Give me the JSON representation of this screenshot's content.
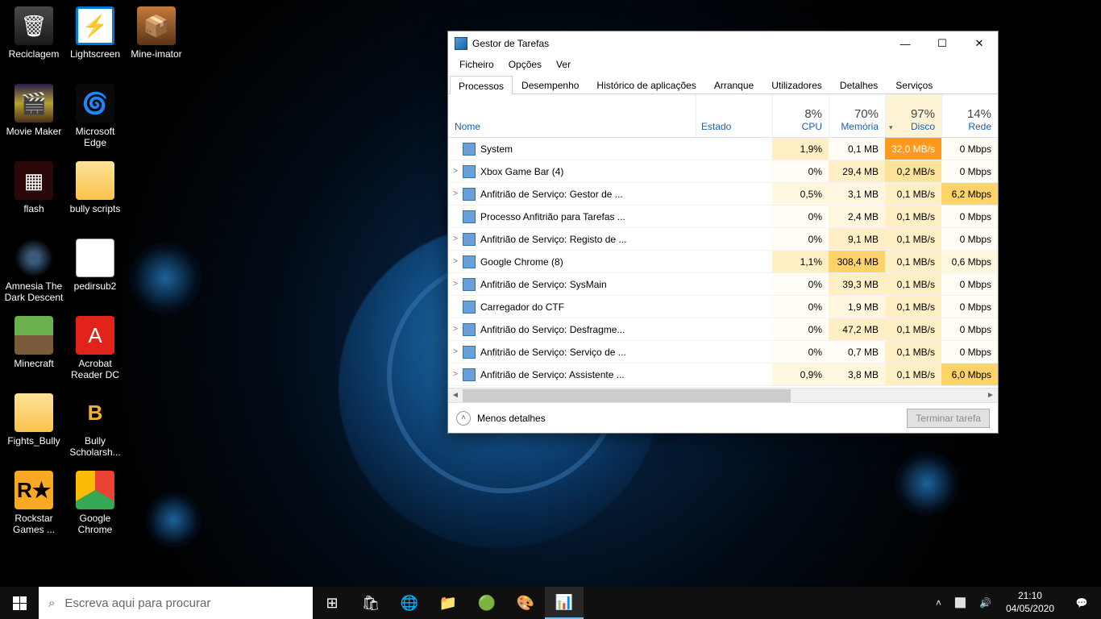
{
  "desktop_icons": [
    {
      "label": "Reciclagem",
      "cls": "recycle-bin",
      "glyph": "🗑"
    },
    {
      "label": "Lightscreen",
      "cls": "lightscreen",
      "glyph": "⚡"
    },
    {
      "label": "Mine-imator",
      "cls": "mine-imator",
      "glyph": "📦"
    },
    {
      "label": "Movie Maker",
      "cls": "moviemaker",
      "glyph": "🎬"
    },
    {
      "label": "Microsoft Edge",
      "cls": "edge",
      "glyph": "🌀"
    },
    {
      "label": "",
      "cls": "",
      "glyph": ""
    },
    {
      "label": "flash",
      "cls": "flash",
      "glyph": "▦"
    },
    {
      "label": "bully scripts",
      "cls": "folder",
      "glyph": ""
    },
    {
      "label": "",
      "cls": "",
      "glyph": ""
    },
    {
      "label": "Amnesia The Dark Descent",
      "cls": "amnesia",
      "glyph": ""
    },
    {
      "label": "pedirsub2",
      "cls": "textfile",
      "glyph": ""
    },
    {
      "label": "",
      "cls": "",
      "glyph": ""
    },
    {
      "label": "Minecraft",
      "cls": "minecraft",
      "glyph": ""
    },
    {
      "label": "Acrobat Reader DC",
      "cls": "acrobat",
      "glyph": "A"
    },
    {
      "label": "",
      "cls": "",
      "glyph": ""
    },
    {
      "label": "Fights_Bully",
      "cls": "folder",
      "glyph": ""
    },
    {
      "label": "Bully Scholarsh...",
      "cls": "bullyicon",
      "glyph": "B"
    },
    {
      "label": "",
      "cls": "",
      "glyph": ""
    },
    {
      "label": "Rockstar Games ...",
      "cls": "rockstar",
      "glyph": "R★"
    },
    {
      "label": "Google Chrome",
      "cls": "chrome",
      "glyph": ""
    }
  ],
  "window": {
    "title": "Gestor de Tarefas",
    "menu": [
      "Ficheiro",
      "Opções",
      "Ver"
    ],
    "tabs": [
      "Processos",
      "Desempenho",
      "Histórico de aplicações",
      "Arranque",
      "Utilizadores",
      "Detalhes",
      "Serviços"
    ],
    "active_tab": 0,
    "columns": {
      "name": "Nome",
      "state": "Estado",
      "cpu": {
        "pct": "8%",
        "label": "CPU"
      },
      "mem": {
        "pct": "70%",
        "label": "Memória"
      },
      "disk": {
        "pct": "97%",
        "label": "Disco"
      },
      "net": {
        "pct": "14%",
        "label": "Rede"
      }
    },
    "rows": [
      {
        "exp": "",
        "name": "System",
        "cpu": "1,9%",
        "mem": "0,1 MB",
        "disk": "32,0 MB/s",
        "net": "0 Mbps",
        "heat": [
          2,
          0,
          6,
          0
        ]
      },
      {
        "exp": ">",
        "name": "Xbox Game Bar (4)",
        "cpu": "0%",
        "mem": "29,4 MB",
        "disk": "0,2 MB/s",
        "net": "0 Mbps",
        "heat": [
          0,
          2,
          3,
          0
        ]
      },
      {
        "exp": ">",
        "name": "Anfitrião de Serviço: Gestor de ...",
        "cpu": "0,5%",
        "mem": "3,1 MB",
        "disk": "0,1 MB/s",
        "net": "6,2 Mbps",
        "heat": [
          1,
          1,
          2,
          4
        ]
      },
      {
        "exp": "",
        "name": "Processo Anfitrião para Tarefas ...",
        "cpu": "0%",
        "mem": "2,4 MB",
        "disk": "0,1 MB/s",
        "net": "0 Mbps",
        "heat": [
          0,
          1,
          2,
          0
        ]
      },
      {
        "exp": ">",
        "name": "Anfitrião de Serviço: Registo de ...",
        "cpu": "0%",
        "mem": "9,1 MB",
        "disk": "0,1 MB/s",
        "net": "0 Mbps",
        "heat": [
          0,
          2,
          2,
          0
        ]
      },
      {
        "exp": ">",
        "name": "Google Chrome (8)",
        "cpu": "1,1%",
        "mem": "308,4 MB",
        "disk": "0,1 MB/s",
        "net": "0,6 Mbps",
        "heat": [
          2,
          4,
          2,
          1
        ]
      },
      {
        "exp": ">",
        "name": "Anfitrião de Serviço: SysMain",
        "cpu": "0%",
        "mem": "39,3 MB",
        "disk": "0,1 MB/s",
        "net": "0 Mbps",
        "heat": [
          0,
          2,
          2,
          0
        ]
      },
      {
        "exp": "",
        "name": "Carregador do CTF",
        "cpu": "0%",
        "mem": "1,9 MB",
        "disk": "0,1 MB/s",
        "net": "0 Mbps",
        "heat": [
          0,
          1,
          2,
          0
        ]
      },
      {
        "exp": ">",
        "name": "Anfitrião do Serviço: Desfragme...",
        "cpu": "0%",
        "mem": "47,2 MB",
        "disk": "0,1 MB/s",
        "net": "0 Mbps",
        "heat": [
          0,
          2,
          2,
          0
        ]
      },
      {
        "exp": ">",
        "name": "Anfitrião de Serviço: Serviço de ...",
        "cpu": "0%",
        "mem": "0,7 MB",
        "disk": "0,1 MB/s",
        "net": "0 Mbps",
        "heat": [
          0,
          0,
          2,
          0
        ]
      },
      {
        "exp": ">",
        "name": "Anfitrião de Serviço: Assistente ...",
        "cpu": "0,9%",
        "mem": "3,8 MB",
        "disk": "0,1 MB/s",
        "net": "6,0 Mbps",
        "heat": [
          1,
          1,
          2,
          4
        ]
      }
    ],
    "less_details": "Menos detalhes",
    "end_task": "Terminar tarefa"
  },
  "taskbar": {
    "search_placeholder": "Escreva aqui para procurar",
    "time": "21:10",
    "date": "04/05/2020"
  }
}
